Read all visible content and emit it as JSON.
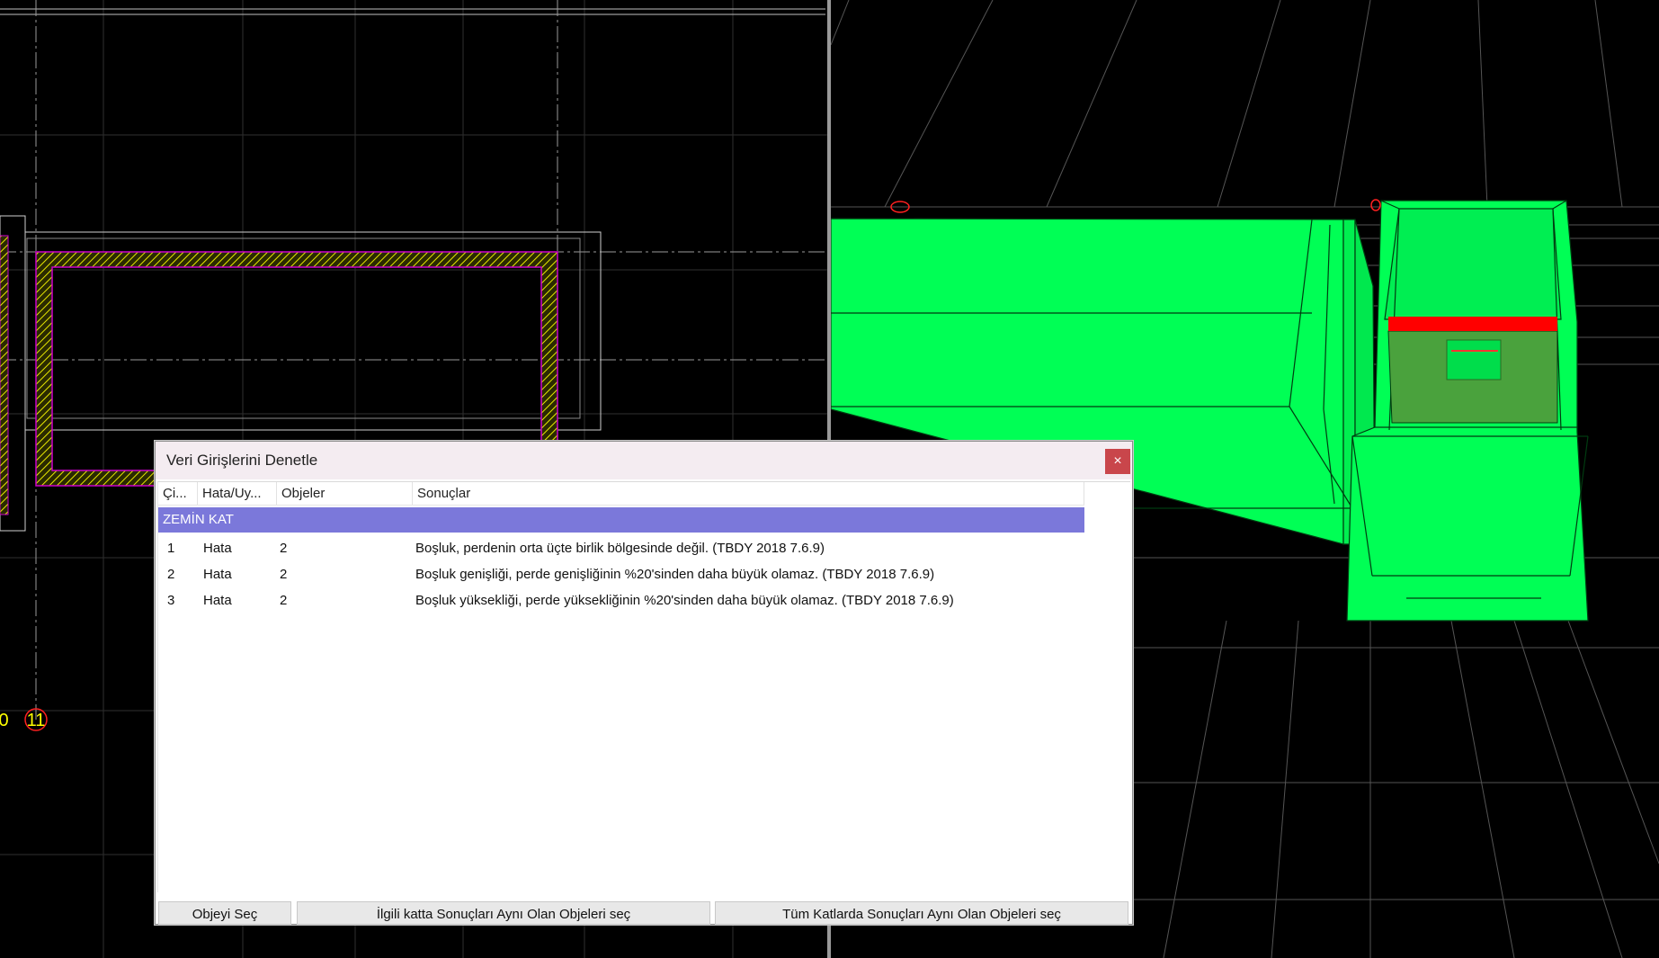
{
  "plan_view": {
    "axis_labels": [
      "0",
      "11"
    ]
  },
  "dialog": {
    "title": "Veri Girişlerini Denetle",
    "close_label": "×",
    "columns": [
      "Çi...",
      "Hata/Uy...",
      "Objeler",
      "Sonuçlar"
    ],
    "group_label": "ZEMİN KAT",
    "group_color": "#7b78da",
    "rows": [
      {
        "no": "1",
        "type": "Hata",
        "objects": "2",
        "result": "Boşluk, perdenin orta üçte birlik bölgesinde değil. (TBDY 2018 7.6.9)"
      },
      {
        "no": "2",
        "type": "Hata",
        "objects": "2",
        "result": "Boşluk genişliği, perde genişliğinin %20'sinden daha büyük olamaz. (TBDY 2018 7.6.9)"
      },
      {
        "no": "3",
        "type": "Hata",
        "objects": "2",
        "result": "Boşluk yüksekliği, perde yüksekliğinin %20'sinden daha büyük olamaz. (TBDY 2018 7.6.9)"
      }
    ],
    "buttons": {
      "select_object": "Objeyi Seç",
      "select_same_floor": "İlgili katta Sonuçları Aynı Olan Objeleri seç",
      "select_all_floors": "Tüm Katlarda Sonuçları Aynı Olan Objeleri seç"
    }
  },
  "colors": {
    "background": "#000000",
    "wall_3d": "#00ff55",
    "error_highlight": "#ff0000",
    "plan_wall_hatch": "#e8e800"
  }
}
